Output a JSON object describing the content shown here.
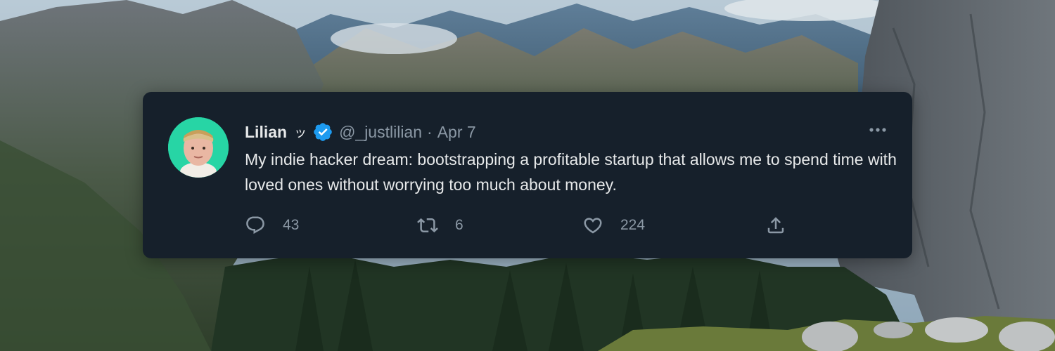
{
  "tweet": {
    "name": "Lilian",
    "name_emoji": "ッ",
    "handle": "@_justlilian",
    "separator": "·",
    "date": "Apr 7",
    "text": "My indie hacker dream: bootstrapping a profitable startup that allows me to spend time with loved ones without worrying too much about money.",
    "verified_color": "#1d9bf0"
  },
  "actions": {
    "reply_count": "43",
    "retweet_count": "6",
    "like_count": "224"
  },
  "icons": {
    "reply": "reply-icon",
    "retweet": "retweet-icon",
    "like": "heart-icon",
    "share": "share-icon",
    "more": "more-dots-icon",
    "verified": "verified-badge-icon"
  },
  "colors": {
    "card_background": "#16202b",
    "avatar_background": "#27d5a5",
    "text_primary": "#e7e9ea",
    "text_secondary": "#8b98a5"
  }
}
